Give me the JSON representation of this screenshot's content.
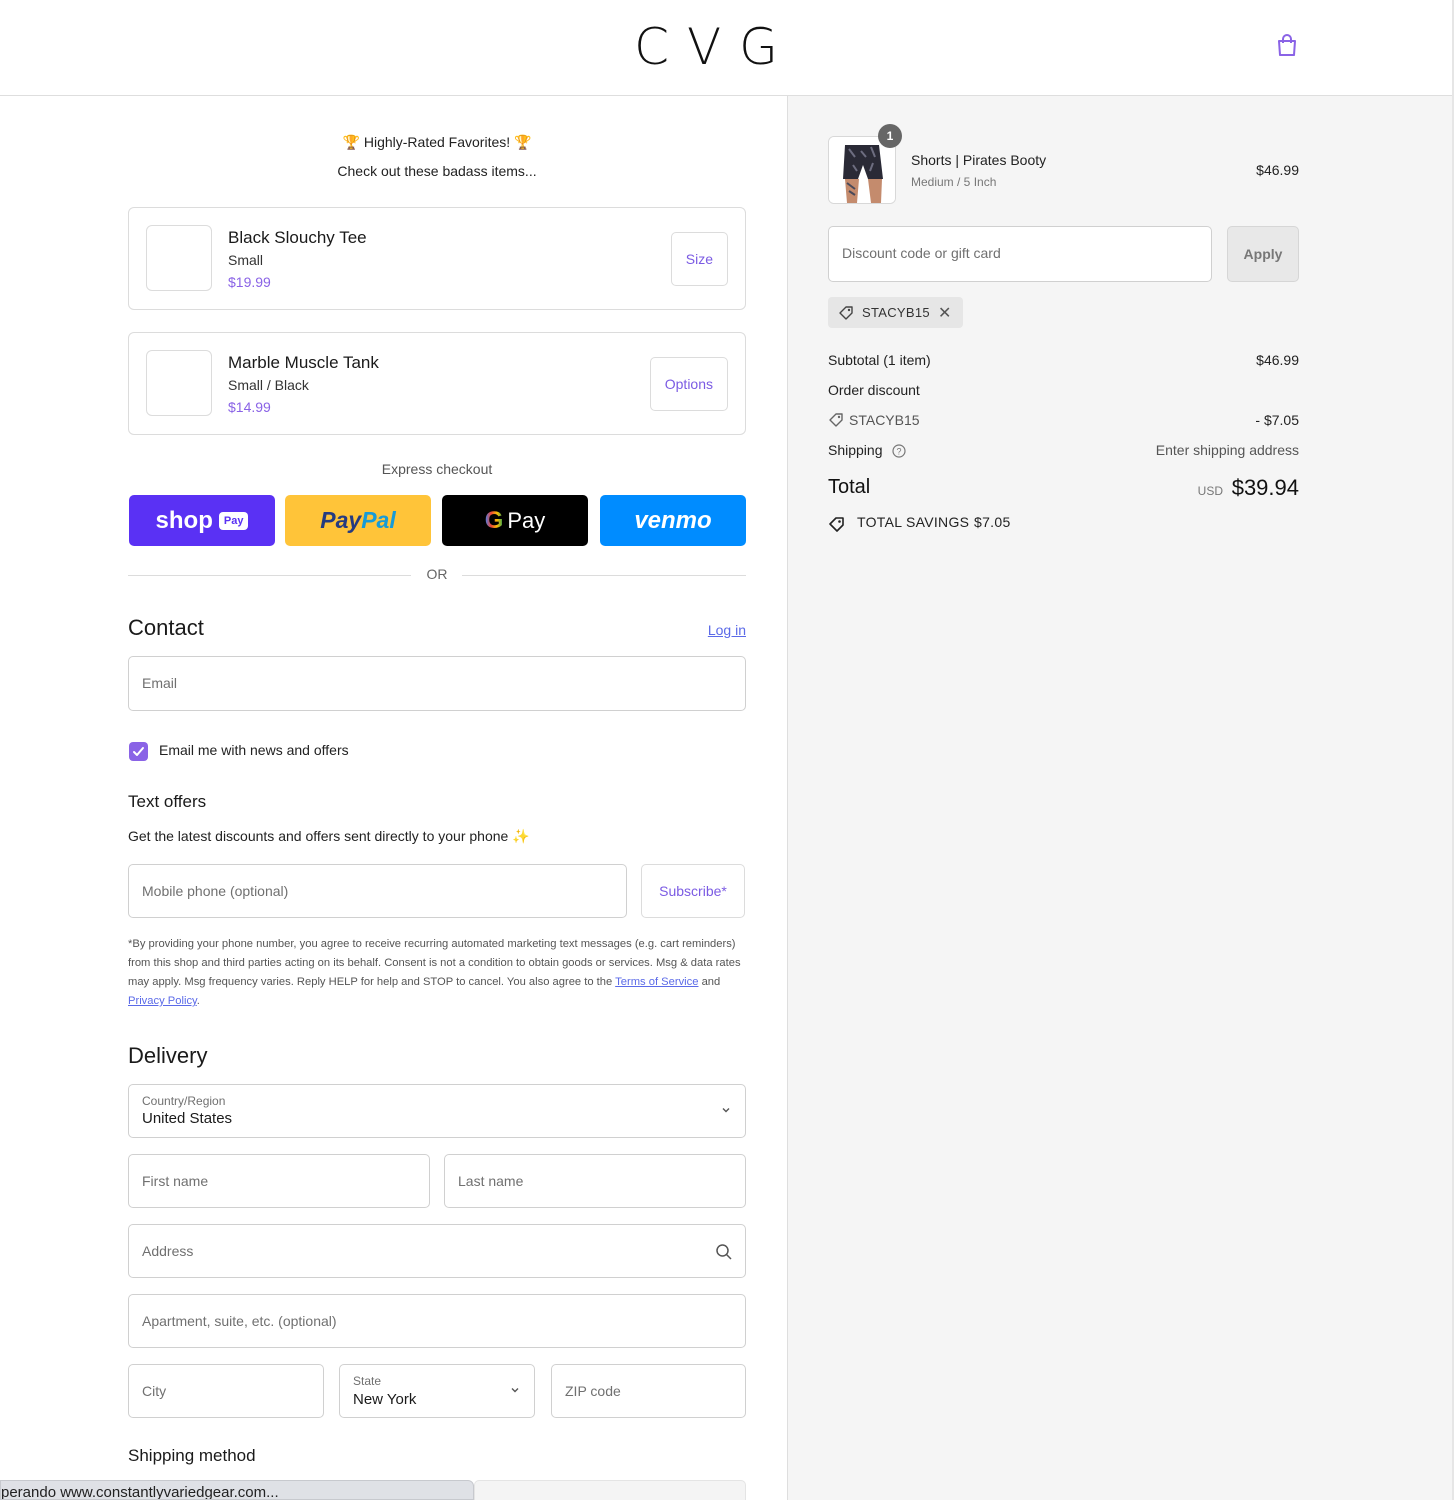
{
  "header": {
    "logo": "CVG",
    "cart_icon": "shopping-bag-icon",
    "accent": "#8a63e6"
  },
  "upsell": {
    "heading": "🏆 Highly-Rated Favorites! 🏆",
    "subheading": "Check out these badass items...",
    "items": [
      {
        "name": "Black Slouchy Tee",
        "variant": "Small",
        "price": "$19.99",
        "button": "Size"
      },
      {
        "name": "Marble Muscle Tank",
        "variant": "Small / Black",
        "price": "$14.99",
        "button": "Options"
      }
    ]
  },
  "express": {
    "label": "Express checkout",
    "shop_pay": {
      "word": "shop",
      "badge": "Pay",
      "color": "#5a31f4"
    },
    "paypal": {
      "part1": "Pay",
      "part2": "Pal",
      "color": "#ffc439"
    },
    "gpay": {
      "g": "G",
      "word": "Pay",
      "color": "#000000"
    },
    "venmo": {
      "word": "venmo",
      "color": "#008cff"
    },
    "or": "OR"
  },
  "contact": {
    "title": "Contact",
    "login_link": "Log in",
    "email_placeholder": "Email",
    "newsletter_label": "Email me with news and offers",
    "newsletter_checked": true
  },
  "text_offers": {
    "title": "Text offers",
    "description": "Get the latest discounts and offers sent directly to your phone ✨",
    "phone_placeholder": "Mobile phone (optional)",
    "subscribe": "Subscribe*",
    "disclaimer_1": "*By providing your phone number, you agree to receive recurring automated marketing text messages (e.g. cart reminders) from this shop and third parties acting on its behalf. Consent is not a condition to obtain goods or services. Msg & data rates may apply. Msg frequency varies. Reply HELP for help and STOP to cancel. You also agree to the ",
    "terms": "Terms of Service",
    "and": " and ",
    "privacy": "Privacy Policy",
    "end": "."
  },
  "delivery": {
    "title": "Delivery",
    "country_label": "Country/Region",
    "country": "United States",
    "first_name": "First name",
    "last_name": "Last name",
    "address": "Address",
    "apartment": "Apartment, suite, etc. (optional)",
    "city": "City",
    "state_label": "State",
    "state": "New York",
    "zip": "ZIP code",
    "shipping_method": "Shipping method"
  },
  "status_bar": {
    "text": "perando www.constantlyvariedgear.com..."
  },
  "summary": {
    "product": {
      "name": "Shorts | Pirates Booty",
      "variant": "Medium / 5 Inch",
      "price": "$46.99",
      "quantity": "1"
    },
    "discount_placeholder": "Discount code or gift card",
    "apply": "Apply",
    "applied_code": "STACYB15",
    "subtotal_label": "Subtotal (1 item)",
    "subtotal": "$46.99",
    "order_discount_label": "Order discount",
    "discount_code": "STACYB15",
    "discount_amount": "- $7.05",
    "shipping_label": "Shipping",
    "shipping_value": "Enter shipping address",
    "total_label": "Total",
    "currency": "USD",
    "total": "$39.94",
    "savings_label": "TOTAL SAVINGS",
    "savings": "$7.05"
  }
}
